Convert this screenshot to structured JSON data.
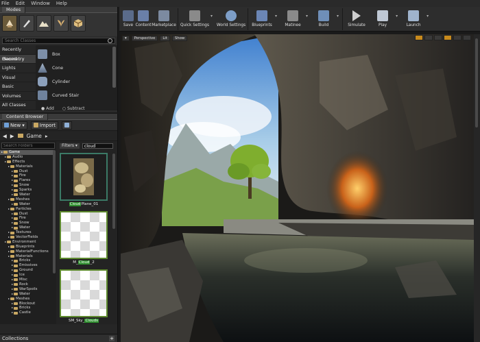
{
  "menu": [
    "File",
    "Edit",
    "Window",
    "Help"
  ],
  "modes": {
    "tab_label": "Modes",
    "search_placeholder": "Search Classes",
    "categories": [
      "Recently Placed",
      "Geometry",
      "Lights",
      "Visual",
      "Basic",
      "Volumes",
      "All Classes"
    ],
    "selected_category": "Geometry",
    "items": [
      "Box",
      "Cone",
      "Cylinder",
      "Curved Stair"
    ],
    "add_label": "Add",
    "subtract_label": "Subtract"
  },
  "content_browser": {
    "tab_label": "Content Browser",
    "new_label": "New",
    "import_label": "Import",
    "path_root": "Game",
    "folder_search_placeholder": "Search Folders",
    "filters_label": "Filters",
    "filter_value": "cloud",
    "tree": [
      {
        "label": "Game",
        "depth": 0,
        "selected": true
      },
      {
        "label": "Audio",
        "depth": 1
      },
      {
        "label": "Effects",
        "depth": 1
      },
      {
        "label": "Materials",
        "depth": 2
      },
      {
        "label": "Dust",
        "depth": 3
      },
      {
        "label": "Fire",
        "depth": 3
      },
      {
        "label": "Flares",
        "depth": 3
      },
      {
        "label": "Snow",
        "depth": 3
      },
      {
        "label": "Sparks",
        "depth": 3
      },
      {
        "label": "Water",
        "depth": 3
      },
      {
        "label": "Meshes",
        "depth": 2
      },
      {
        "label": "Water",
        "depth": 3
      },
      {
        "label": "Particles",
        "depth": 2
      },
      {
        "label": "Dust",
        "depth": 3
      },
      {
        "label": "Fire",
        "depth": 3
      },
      {
        "label": "Snow",
        "depth": 3
      },
      {
        "label": "Water",
        "depth": 3
      },
      {
        "label": "Textures",
        "depth": 2
      },
      {
        "label": "VectorFields",
        "depth": 2
      },
      {
        "label": "Environment",
        "depth": 1
      },
      {
        "label": "Blueprints",
        "depth": 2
      },
      {
        "label": "MaterialFunctions",
        "depth": 2
      },
      {
        "label": "Materials",
        "depth": 2
      },
      {
        "label": "Bricks",
        "depth": 3
      },
      {
        "label": "Emissives",
        "depth": 3
      },
      {
        "label": "Ground",
        "depth": 3
      },
      {
        "label": "Ice",
        "depth": 3
      },
      {
        "label": "Misc",
        "depth": 3
      },
      {
        "label": "Rock",
        "depth": 3
      },
      {
        "label": "WarSpoils",
        "depth": 3
      },
      {
        "label": "Water",
        "depth": 3
      },
      {
        "label": "Meshes",
        "depth": 2
      },
      {
        "label": "Blockout",
        "depth": 3
      },
      {
        "label": "Bricks",
        "depth": 3
      },
      {
        "label": "Castle",
        "depth": 3
      }
    ],
    "assets": [
      {
        "prefix": "",
        "highlight": "Cloud",
        "suffix": "Plane_01",
        "thumb": "cloud"
      },
      {
        "prefix": "M_",
        "highlight": "Cloud",
        "suffix": "_2",
        "thumb": "checker"
      },
      {
        "prefix": "SM_Sky_",
        "highlight": "Clouds",
        "suffix": "",
        "thumb": "checker"
      }
    ],
    "collections_label": "Collections"
  },
  "toolbar": [
    {
      "label": "Save",
      "icon": "save-icon",
      "color": "#5a6b8a",
      "width": "normal"
    },
    {
      "label": "Content",
      "icon": "content-icon",
      "color": "#6a7fa8",
      "width": "normal"
    },
    {
      "label": "Marketplace",
      "icon": "marketplace-icon",
      "color": "#7c8aa0",
      "width": "wide"
    },
    {
      "label": "Quick Settings",
      "icon": "gear-icon",
      "color": "#8a8a8a",
      "width": "xwide",
      "dropdown": true
    },
    {
      "label": "World Settings",
      "icon": "globe-icon",
      "color": "#7d9ec7",
      "width": "xwide"
    },
    {
      "label": "Blueprints",
      "icon": "blueprint-icon",
      "color": "#6b86b5",
      "width": "wide",
      "dropdown": true
    },
    {
      "label": "Matinee",
      "icon": "matinee-icon",
      "color": "#8a8a8a",
      "width": "wide",
      "dropdown": true
    },
    {
      "label": "Build",
      "icon": "build-icon",
      "color": "#6f8fb8",
      "width": "wide",
      "dropdown": true
    },
    {
      "label": "Simulate",
      "icon": "play-icon",
      "color": "#cfcfcf",
      "width": "wide"
    },
    {
      "label": "Play",
      "icon": "gamepad-icon",
      "color": "#bfc8d4",
      "width": "wide",
      "dropdown": true
    },
    {
      "label": "Launch",
      "icon": "launch-icon",
      "color": "#9fb3cc",
      "width": "wide",
      "dropdown": true
    }
  ],
  "viewport": {
    "perspective_label": "Perspective",
    "lit_label": "Lit",
    "show_label": "Show",
    "accent": "#c88a1c"
  },
  "colors": {
    "panel": "#2b2b2b",
    "highlight_green": "#2f8f2f",
    "thumb_border": "#5e8a2e"
  }
}
